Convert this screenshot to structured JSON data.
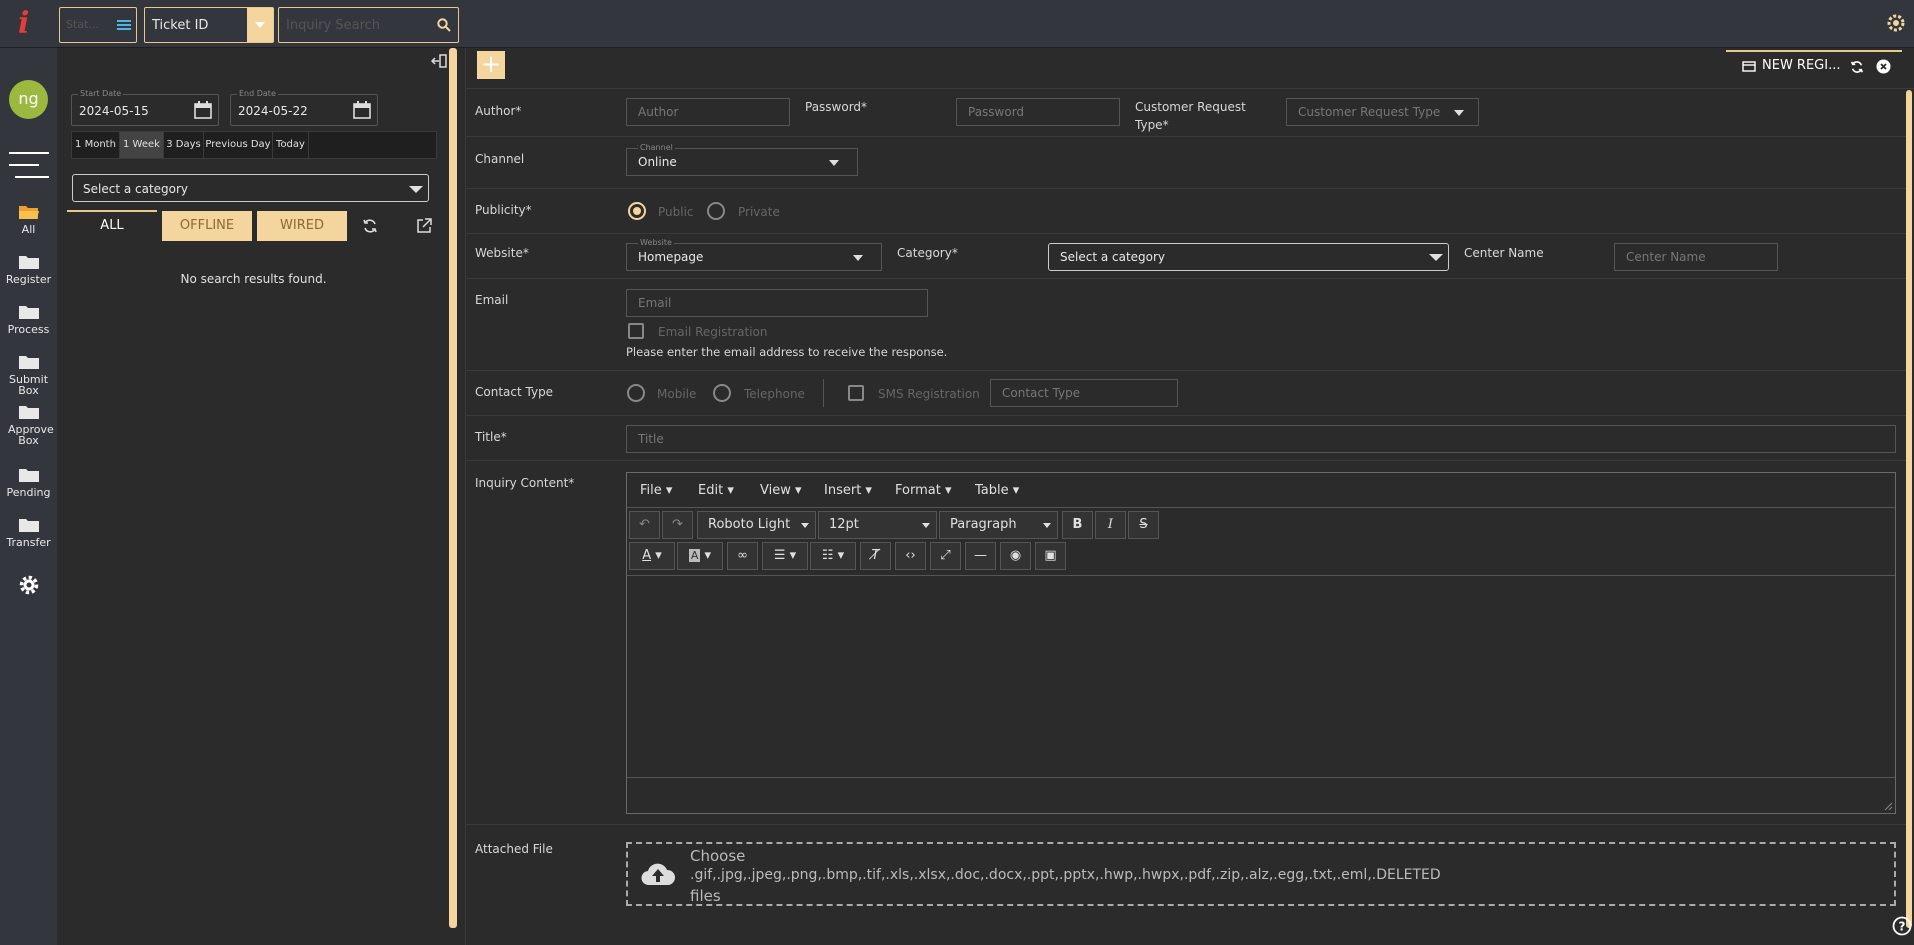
{
  "app": {
    "logo": "i"
  },
  "topbar": {
    "status_placeholder": "Stat...",
    "ticket_select": "Ticket ID",
    "search_placeholder": "Inquiry Search"
  },
  "user": {
    "initials": "ng"
  },
  "nav": [
    {
      "label": "All",
      "icon": "folder-open-icon"
    },
    {
      "label": "Register",
      "icon": "folder-icon"
    },
    {
      "label": "Process",
      "icon": "folder-icon"
    },
    {
      "label": "Submit Box",
      "icon": "folder-icon"
    },
    {
      "label": "Approve Box",
      "icon": "folder-icon"
    },
    {
      "label": "Pending",
      "icon": "folder-icon"
    },
    {
      "label": "Transfer",
      "icon": "folder-icon"
    }
  ],
  "list": {
    "start_label": "Start Date",
    "start_value": "2024-05-15",
    "end_label": "End Date",
    "end_value": "2024-05-22",
    "ranges": [
      "1 Month",
      "1 Week",
      "3 Days",
      "Previous Day",
      "Today"
    ],
    "active_range": "1 Week",
    "category_placeholder": "Select a category",
    "tabs": [
      "ALL",
      "OFFLINE",
      "WIRED"
    ],
    "empty_message": "No search results found."
  },
  "main": {
    "tab_title": "NEW REGI...",
    "colors": {
      "accent": "#f3d59d",
      "accent_border": "#e8c98a",
      "logo": "#e83b3b"
    },
    "form": {
      "author_label": "Author*",
      "author_placeholder": "Author",
      "password_label": "Password*",
      "password_placeholder": "Password",
      "crt_label_1": "Customer Request",
      "crt_label_2": "Type*",
      "crt_placeholder": "Customer Request Type",
      "channel_label": "Channel",
      "channel_mini": "Channel",
      "channel_value": "Online",
      "publicity_label": "Publicity*",
      "public_label": "Public",
      "private_label": "Private",
      "website_label": "Website*",
      "website_mini": "Website",
      "website_value": "Homepage",
      "category_label": "Category*",
      "category_placeholder": "Select a category",
      "center_label": "Center Name",
      "center_placeholder": "Center Name",
      "email_label": "Email",
      "email_placeholder": "Email",
      "email_registration": "Email Registration",
      "email_hint": "Please enter the email address to receive the response.",
      "contact_label": "Contact Type",
      "mobile_label": "Mobile",
      "telephone_label": "Telephone",
      "sms_label": "SMS Registration",
      "contact_placeholder": "Contact Type",
      "title_label": "Title*",
      "title_placeholder": "Title",
      "inquiry_label": "Inquiry Content*",
      "attached_label": "Attached File",
      "attach_line1": "Choose",
      "attach_line2": ".gif,.jpg,.jpeg,.png,.bmp,.tif,.xls,.xlsx,.doc,.docx,.ppt,.pptx,.hwp,.hwpx,.pdf,.zip,.alz,.egg,.txt,.eml,.DELETED",
      "attach_line3": "files"
    },
    "editor": {
      "menus": [
        "File",
        "Edit",
        "View",
        "Insert",
        "Format",
        "Table"
      ],
      "font_family": "Roboto Light",
      "font_size": "12pt",
      "block_format": "Paragraph"
    }
  }
}
